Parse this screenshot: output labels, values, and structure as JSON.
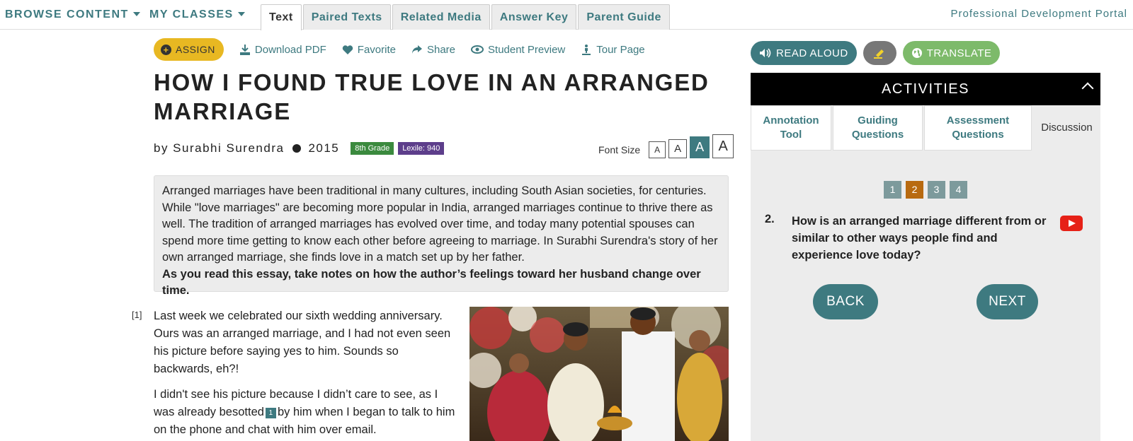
{
  "nav": {
    "browse": "BROWSE CONTENT",
    "classes": "MY CLASSES",
    "tabs": [
      "Text",
      "Paired Texts",
      "Related Media",
      "Answer Key",
      "Parent Guide"
    ],
    "portal": "Professional Development Portal"
  },
  "toolbar": {
    "assign": "ASSIGN",
    "download": "Download PDF",
    "favorite": "Favorite",
    "share": "Share",
    "preview": "Student Preview",
    "tour": "Tour Page"
  },
  "article": {
    "title": "HOW I FOUND TRUE LOVE IN AN ARRANGED MARRIAGE",
    "author": "by Surabhi Surendra",
    "year": "2015",
    "grade": "8th Grade",
    "lexile": "Lexile: 940",
    "font_size_label": "Font Size",
    "font_sizes": [
      "A",
      "A",
      "A",
      "A"
    ],
    "intro": "Arranged marriages have been traditional in many cultures, including South Asian societies, for centuries. While \"love marriages\" are becoming more popular in India, arranged marriages continue to thrive there as well. The tradition of arranged marriages has evolved over time, and today many potential spouses can spend more time getting to know each other before agreeing to marriage. In Surabhi Surendra's story of her own arranged marriage, she finds love in a match set up by her father.",
    "intro_prompt": "As you read this essay, take notes on how the author’s feelings toward her husband change over time.",
    "para_num": "[1]",
    "para1": "Last week we celebrated our sixth wedding anniversary. Ours was an arranged marriage, and I had not even seen his picture before saying yes to him. Sounds so backwards, eh?!",
    "para2_a": "I didn't see his picture because I didn’t care to see, as I was already besotted",
    "footnote": "1",
    "para2_b": "by him when I began to talk to him on the phone and chat with him over email."
  },
  "right": {
    "read_aloud": "READ ALOUD",
    "translate": "TRANSLATE",
    "activities": "ACTIVITIES",
    "tabs": [
      "Annotation Tool",
      "Guiding Questions",
      "Assessment Questions",
      "Discussion"
    ],
    "question_numbers": [
      "1",
      "2",
      "3",
      "4"
    ],
    "question_number": "2.",
    "question": "How is an arranged marriage different from or similar to other ways people find and experience love today?",
    "back": "BACK",
    "next": "NEXT"
  },
  "colors": {
    "accent": "#3e7a80",
    "assign": "#e8b822",
    "grade_badge": "#3b8a3e",
    "lexile_badge": "#5d3e8b",
    "active_question": "#b86a10",
    "translate": "#7dba6a"
  }
}
